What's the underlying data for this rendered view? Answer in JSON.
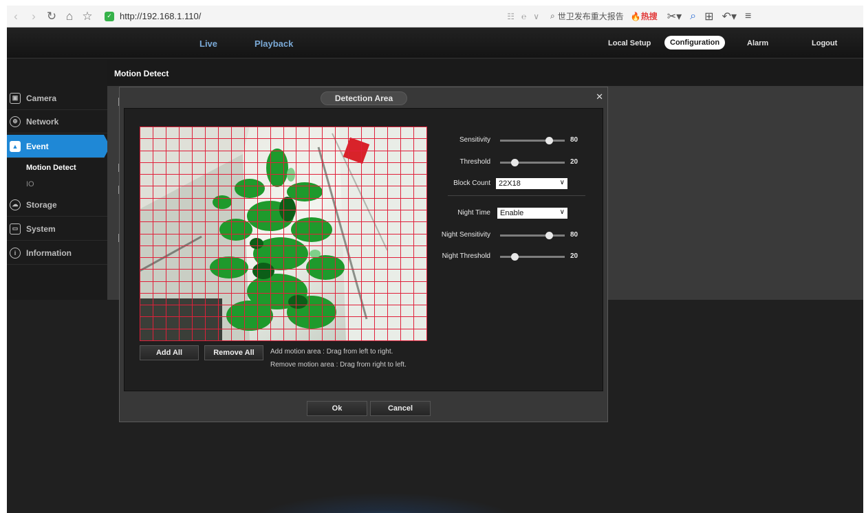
{
  "browser": {
    "url": "http://192.168.1.110/",
    "search_text": "世卫发布重大报告",
    "hot_label": "热搜"
  },
  "topnav": {
    "live": "Live",
    "playback": "Playback",
    "local_setup": "Local Setup",
    "configuration": "Configuration",
    "alarm": "Alarm",
    "logout": "Logout"
  },
  "sidebar": {
    "items": [
      {
        "label": "Camera",
        "icon": "camera-icon"
      },
      {
        "label": "Network",
        "icon": "network-icon"
      },
      {
        "label": "Event",
        "icon": "event-icon"
      },
      {
        "label": "Storage",
        "icon": "storage-icon"
      },
      {
        "label": "System",
        "icon": "system-icon"
      },
      {
        "label": "Information",
        "icon": "info-icon"
      }
    ],
    "subitems": [
      "Motion Detect",
      "IO"
    ]
  },
  "page": {
    "title": "Motion Detect"
  },
  "dialog": {
    "title": "Detection Area",
    "add_all": "Add All",
    "remove_all": "Remove All",
    "help_add": "Add motion area : Drag from left to right.",
    "help_remove": "Remove motion area : Drag from right to left.",
    "ok": "Ok",
    "cancel": "Cancel",
    "controls": {
      "sensitivity_label": "Sensitivity",
      "sensitivity_value": "80",
      "threshold_label": "Threshold",
      "threshold_value": "20",
      "block_count_label": "Block Count",
      "block_count_value": "22X18",
      "night_time_label": "Night Time",
      "night_time_value": "Enable",
      "night_sensitivity_label": "Night Sensitivity",
      "night_sensitivity_value": "80",
      "night_threshold_label": "Night Threshold",
      "night_threshold_value": "20"
    },
    "grid": {
      "columns": 22,
      "rows": 18,
      "line_color": "#e0203a"
    }
  },
  "colors": {
    "accent": "#1f88d6",
    "nav_link": "#7aa9d6"
  }
}
